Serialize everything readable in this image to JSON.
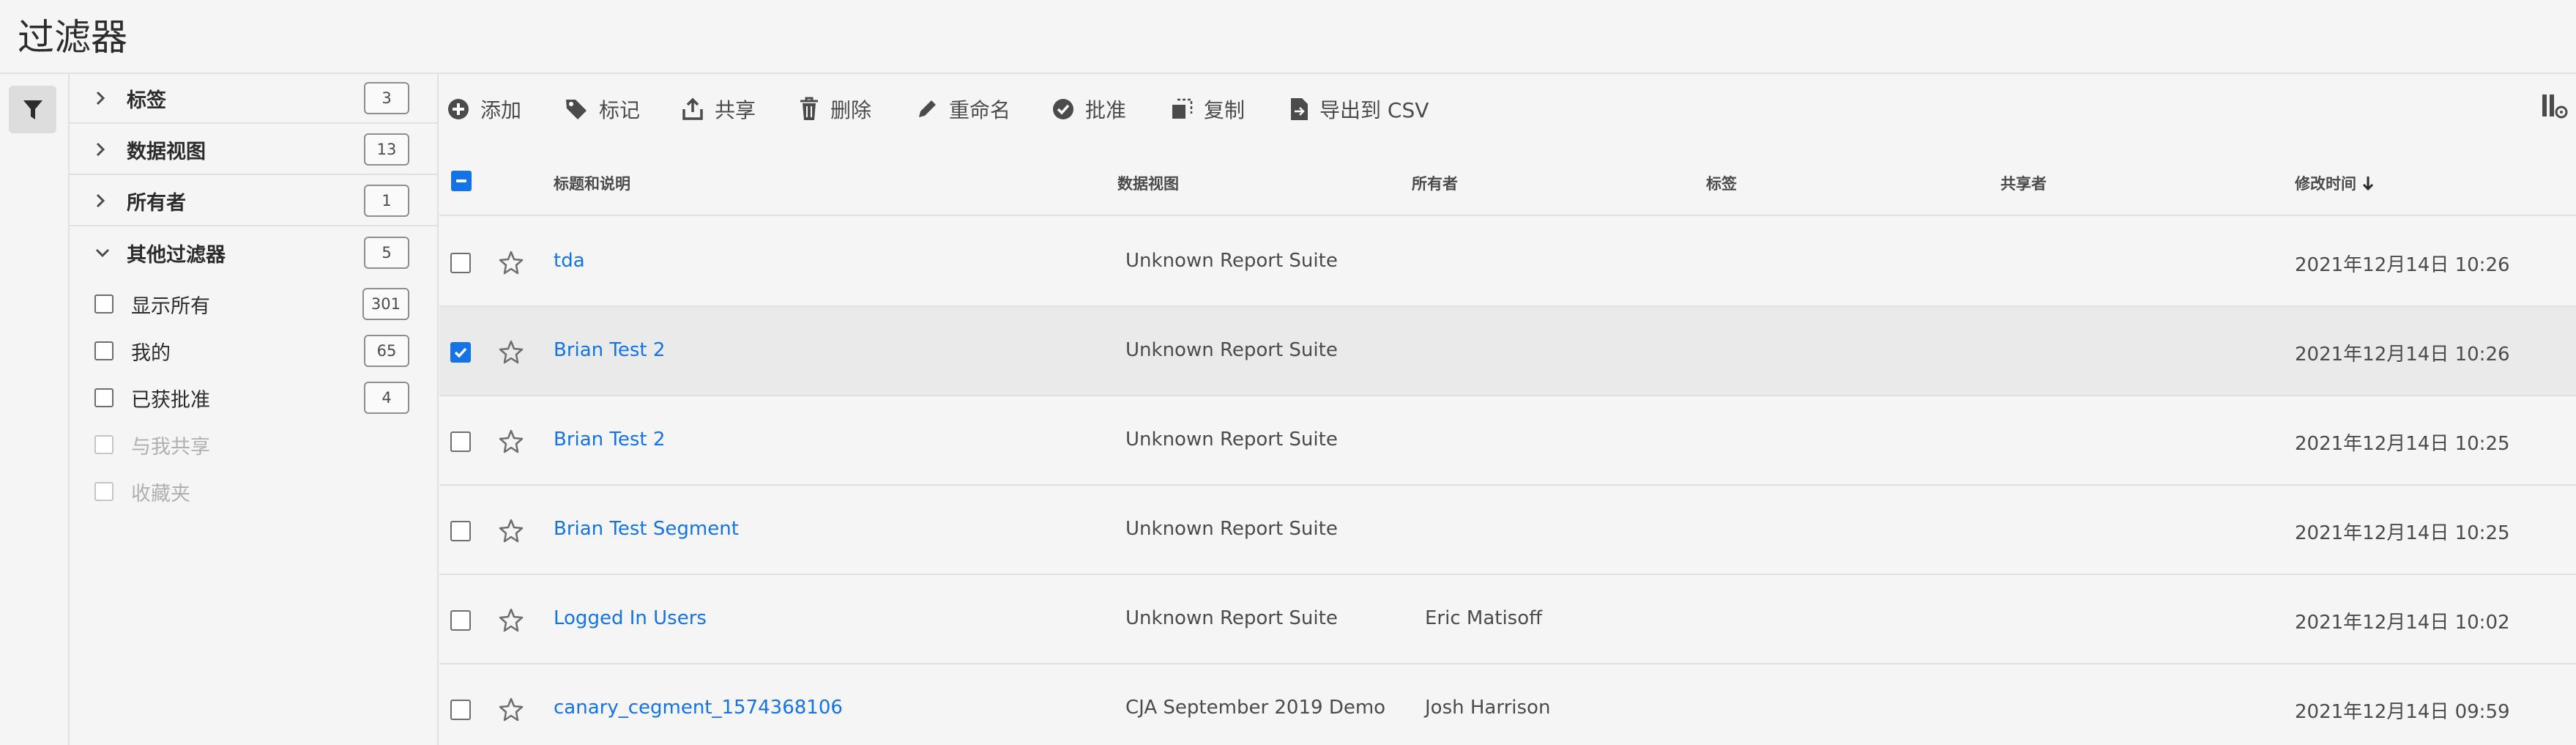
{
  "page": {
    "title": "过滤器"
  },
  "rail": {
    "filter_icon": "filter-icon"
  },
  "filter_panel": {
    "groups": [
      {
        "label": "标签",
        "count": "3",
        "expanded": false
      },
      {
        "label": "数据视图",
        "count": "13",
        "expanded": false
      },
      {
        "label": "所有者",
        "count": "1",
        "expanded": false
      },
      {
        "label": "其他过滤器",
        "count": "5",
        "expanded": true
      }
    ],
    "other_filters": [
      {
        "label": "显示所有",
        "count": "301",
        "disabled": false
      },
      {
        "label": "我的",
        "count": "65",
        "disabled": false
      },
      {
        "label": "已获批准",
        "count": "4",
        "disabled": false
      },
      {
        "label": "与我共享",
        "count": "",
        "disabled": true
      },
      {
        "label": "收藏夹",
        "count": "",
        "disabled": true
      }
    ]
  },
  "toolbar": {
    "add": "添加",
    "tag": "标记",
    "share": "共享",
    "delete": "删除",
    "rename": "重命名",
    "approve": "批准",
    "copy": "复制",
    "export_csv": "导出到 CSV"
  },
  "table": {
    "columns": {
      "title": "标题和说明",
      "data_view": "数据视图",
      "owner": "所有者",
      "tags": "标签",
      "shared_with": "共享者",
      "modified": "修改时间"
    },
    "sort": {
      "column": "modified",
      "direction": "descending"
    },
    "rows": [
      {
        "title": "tda",
        "data_view": "Unknown Report Suite",
        "owner": "",
        "tags": "",
        "shared_with": "",
        "modified": "2021年12月14日 10:26",
        "checked": false
      },
      {
        "title": "Brian Test 2",
        "data_view": "Unknown Report Suite",
        "owner": "",
        "tags": "",
        "shared_with": "",
        "modified": "2021年12月14日 10:26",
        "checked": true
      },
      {
        "title": "Brian Test 2",
        "data_view": "Unknown Report Suite",
        "owner": "",
        "tags": "",
        "shared_with": "",
        "modified": "2021年12月14日 10:25",
        "checked": false
      },
      {
        "title": "Brian Test Segment",
        "data_view": "Unknown Report Suite",
        "owner": "",
        "tags": "",
        "shared_with": "",
        "modified": "2021年12月14日 10:25",
        "checked": false
      },
      {
        "title": "Logged In Users",
        "data_view": "Unknown Report Suite",
        "owner": "Eric Matisoff",
        "tags": "",
        "shared_with": "",
        "modified": "2021年12月14日 10:02",
        "checked": false
      },
      {
        "title": "canary_cegment_1574368106",
        "data_view": "CJA September 2019 Demo",
        "owner": "Josh Harrison",
        "tags": "",
        "shared_with": "",
        "modified": "2021年12月14日 09:59",
        "checked": false
      }
    ]
  },
  "colors": {
    "accent": "#1473e6",
    "selected_row": "#eaeaea"
  }
}
